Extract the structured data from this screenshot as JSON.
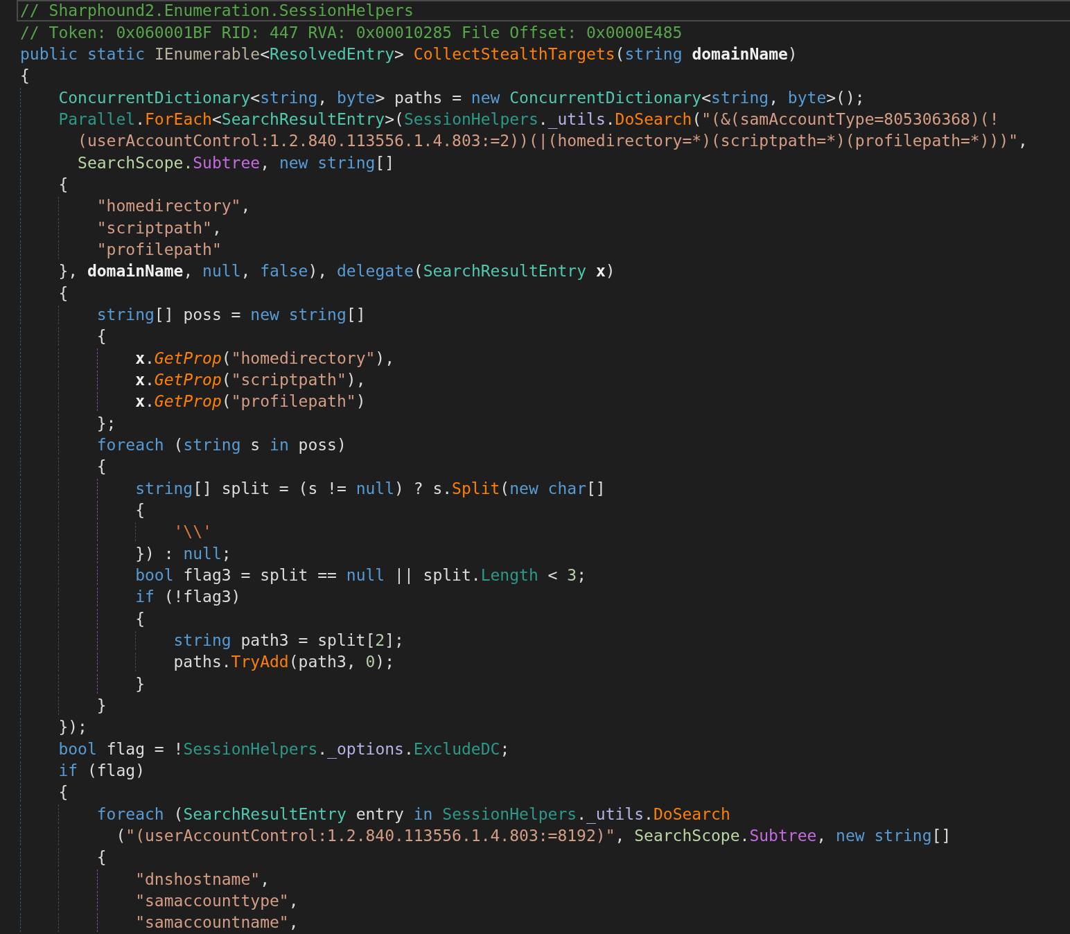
{
  "code_lines": [
    {
      "selected": true,
      "tokens": [
        {
          "kind": "comment",
          "text": "// Sharphound2.Enumeration.SessionHelpers"
        }
      ]
    },
    {
      "selected": false,
      "tokens": [
        {
          "kind": "comment",
          "text": "// Token: 0x060001BF RID: 447 RVA: 0x00010285 File Offset: 0x0000E485"
        }
      ]
    },
    {
      "selected": false,
      "tokens": [
        {
          "kind": "keyword",
          "text": "public static "
        },
        {
          "kind": "interface",
          "text": "IEnumerable"
        },
        {
          "kind": "plain",
          "text": "<"
        },
        {
          "kind": "type",
          "text": "ResolvedEntry"
        },
        {
          "kind": "plain",
          "text": "> "
        },
        {
          "kind": "method",
          "text": "CollectStealthTargets"
        },
        {
          "kind": "plain",
          "text": "("
        },
        {
          "kind": "keyword",
          "text": "string "
        },
        {
          "kind": "param",
          "text": "domainName"
        },
        {
          "kind": "plain",
          "text": ")"
        }
      ]
    },
    {
      "selected": false,
      "tokens": [
        {
          "kind": "plain",
          "text": "{"
        }
      ]
    },
    {
      "selected": false,
      "tokens": [
        {
          "kind": "type",
          "text": "    ConcurrentDictionary"
        },
        {
          "kind": "plain",
          "text": "<"
        },
        {
          "kind": "keyword",
          "text": "string"
        },
        {
          "kind": "plain",
          "text": ", "
        },
        {
          "kind": "keyword",
          "text": "byte"
        },
        {
          "kind": "plain",
          "text": "> paths = "
        },
        {
          "kind": "keyword",
          "text": "new "
        },
        {
          "kind": "type",
          "text": "ConcurrentDictionary"
        },
        {
          "kind": "plain",
          "text": "<"
        },
        {
          "kind": "keyword",
          "text": "string"
        },
        {
          "kind": "plain",
          "text": ", "
        },
        {
          "kind": "keyword",
          "text": "byte"
        },
        {
          "kind": "plain",
          "text": ">();"
        }
      ]
    },
    {
      "selected": false,
      "tokens": [
        {
          "kind": "static",
          "text": "    Parallel"
        },
        {
          "kind": "plain",
          "text": "."
        },
        {
          "kind": "method",
          "text": "ForEach"
        },
        {
          "kind": "plain",
          "text": "<"
        },
        {
          "kind": "type",
          "text": "SearchResultEntry"
        },
        {
          "kind": "plain",
          "text": ">("
        },
        {
          "kind": "static",
          "text": "SessionHelpers"
        },
        {
          "kind": "plain",
          "text": "."
        },
        {
          "kind": "field",
          "text": "_utils"
        },
        {
          "kind": "plain",
          "text": "."
        },
        {
          "kind": "method",
          "text": "DoSearch"
        },
        {
          "kind": "plain",
          "text": "("
        },
        {
          "kind": "string",
          "text": "\"(&(samAccountType=805306368)(!"
        }
      ]
    },
    {
      "selected": false,
      "tokens": [
        {
          "kind": "string",
          "text": "      (userAccountControl:1.2.840.113556.1.4.803:=2))(|(homedirectory=*)(scriptpath=*)(profilepath=*)))\""
        },
        {
          "kind": "plain",
          "text": ","
        }
      ]
    },
    {
      "selected": false,
      "tokens": [
        {
          "kind": "enum",
          "text": "      SearchScope."
        },
        {
          "kind": "enumval",
          "text": "Subtree"
        },
        {
          "kind": "plain",
          "text": ", "
        },
        {
          "kind": "keyword",
          "text": "new string"
        },
        {
          "kind": "plain",
          "text": "[]"
        }
      ]
    },
    {
      "selected": false,
      "tokens": [
        {
          "kind": "plain",
          "text": "    {"
        }
      ]
    },
    {
      "selected": false,
      "tokens": [
        {
          "kind": "string",
          "text": "        \"homedirectory\""
        },
        {
          "kind": "plain",
          "text": ","
        }
      ]
    },
    {
      "selected": false,
      "tokens": [
        {
          "kind": "string",
          "text": "        \"scriptpath\""
        },
        {
          "kind": "plain",
          "text": ","
        }
      ]
    },
    {
      "selected": false,
      "tokens": [
        {
          "kind": "string",
          "text": "        \"profilepath\""
        }
      ]
    },
    {
      "selected": false,
      "tokens": [
        {
          "kind": "plain",
          "text": "    }, "
        },
        {
          "kind": "param",
          "text": "domainName"
        },
        {
          "kind": "plain",
          "text": ", "
        },
        {
          "kind": "keyword",
          "text": "null"
        },
        {
          "kind": "plain",
          "text": ", "
        },
        {
          "kind": "keyword",
          "text": "false"
        },
        {
          "kind": "plain",
          "text": "), "
        },
        {
          "kind": "keyword",
          "text": "delegate"
        },
        {
          "kind": "plain",
          "text": "("
        },
        {
          "kind": "type",
          "text": "SearchResultEntry "
        },
        {
          "kind": "param",
          "text": "x"
        },
        {
          "kind": "plain",
          "text": ")"
        }
      ]
    },
    {
      "selected": false,
      "tokens": [
        {
          "kind": "plain",
          "text": "    {"
        }
      ]
    },
    {
      "selected": false,
      "tokens": [
        {
          "kind": "keyword",
          "text": "        string"
        },
        {
          "kind": "plain",
          "text": "[] poss = "
        },
        {
          "kind": "keyword",
          "text": "new string"
        },
        {
          "kind": "plain",
          "text": "[]"
        }
      ]
    },
    {
      "selected": false,
      "tokens": [
        {
          "kind": "plain",
          "text": "        {"
        }
      ]
    },
    {
      "selected": false,
      "tokens": [
        {
          "kind": "param",
          "text": "            x"
        },
        {
          "kind": "plain",
          "text": "."
        },
        {
          "kind": "ext",
          "text": "GetProp"
        },
        {
          "kind": "plain",
          "text": "("
        },
        {
          "kind": "string",
          "text": "\"homedirectory\""
        },
        {
          "kind": "plain",
          "text": "),"
        }
      ]
    },
    {
      "selected": false,
      "tokens": [
        {
          "kind": "param",
          "text": "            x"
        },
        {
          "kind": "plain",
          "text": "."
        },
        {
          "kind": "ext",
          "text": "GetProp"
        },
        {
          "kind": "plain",
          "text": "("
        },
        {
          "kind": "string",
          "text": "\"scriptpath\""
        },
        {
          "kind": "plain",
          "text": "),"
        }
      ]
    },
    {
      "selected": false,
      "tokens": [
        {
          "kind": "param",
          "text": "            x"
        },
        {
          "kind": "plain",
          "text": "."
        },
        {
          "kind": "ext",
          "text": "GetProp"
        },
        {
          "kind": "plain",
          "text": "("
        },
        {
          "kind": "string",
          "text": "\"profilepath\""
        },
        {
          "kind": "plain",
          "text": ")"
        }
      ]
    },
    {
      "selected": false,
      "tokens": [
        {
          "kind": "plain",
          "text": "        };"
        }
      ]
    },
    {
      "selected": false,
      "tokens": [
        {
          "kind": "keyword",
          "text": "        foreach "
        },
        {
          "kind": "plain",
          "text": "("
        },
        {
          "kind": "keyword",
          "text": "string "
        },
        {
          "kind": "plain",
          "text": "s "
        },
        {
          "kind": "keyword",
          "text": "in "
        },
        {
          "kind": "plain",
          "text": "poss)"
        }
      ]
    },
    {
      "selected": false,
      "tokens": [
        {
          "kind": "plain",
          "text": "        {"
        }
      ]
    },
    {
      "selected": false,
      "tokens": [
        {
          "kind": "keyword",
          "text": "            string"
        },
        {
          "kind": "plain",
          "text": "[] split = (s != "
        },
        {
          "kind": "keyword",
          "text": "null"
        },
        {
          "kind": "plain",
          "text": ") ? s."
        },
        {
          "kind": "method",
          "text": "Split"
        },
        {
          "kind": "plain",
          "text": "("
        },
        {
          "kind": "keyword",
          "text": "new char"
        },
        {
          "kind": "plain",
          "text": "[]"
        }
      ]
    },
    {
      "selected": false,
      "tokens": [
        {
          "kind": "plain",
          "text": "            {"
        }
      ]
    },
    {
      "selected": false,
      "tokens": [
        {
          "kind": "char",
          "text": "                '\\\\'"
        }
      ]
    },
    {
      "selected": false,
      "tokens": [
        {
          "kind": "plain",
          "text": "            }) : "
        },
        {
          "kind": "keyword",
          "text": "null"
        },
        {
          "kind": "plain",
          "text": ";"
        }
      ]
    },
    {
      "selected": false,
      "tokens": [
        {
          "kind": "keyword",
          "text": "            bool "
        },
        {
          "kind": "plain",
          "text": "flag3 = split == "
        },
        {
          "kind": "keyword",
          "text": "null "
        },
        {
          "kind": "plain",
          "text": "|| split."
        },
        {
          "kind": "property",
          "text": "Length"
        },
        {
          "kind": "plain",
          "text": " < "
        },
        {
          "kind": "number",
          "text": "3"
        },
        {
          "kind": "plain",
          "text": ";"
        }
      ]
    },
    {
      "selected": false,
      "tokens": [
        {
          "kind": "keyword",
          "text": "            if "
        },
        {
          "kind": "plain",
          "text": "(!flag3)"
        }
      ]
    },
    {
      "selected": false,
      "tokens": [
        {
          "kind": "plain",
          "text": "            {"
        }
      ]
    },
    {
      "selected": false,
      "tokens": [
        {
          "kind": "keyword",
          "text": "                string "
        },
        {
          "kind": "plain",
          "text": "path3 = split["
        },
        {
          "kind": "number",
          "text": "2"
        },
        {
          "kind": "plain",
          "text": "];"
        }
      ]
    },
    {
      "selected": false,
      "tokens": [
        {
          "kind": "plain",
          "text": "                paths."
        },
        {
          "kind": "method",
          "text": "TryAdd"
        },
        {
          "kind": "plain",
          "text": "(path3, "
        },
        {
          "kind": "number",
          "text": "0"
        },
        {
          "kind": "plain",
          "text": ");"
        }
      ]
    },
    {
      "selected": false,
      "tokens": [
        {
          "kind": "plain",
          "text": "            }"
        }
      ]
    },
    {
      "selected": false,
      "tokens": [
        {
          "kind": "plain",
          "text": "        }"
        }
      ]
    },
    {
      "selected": false,
      "tokens": [
        {
          "kind": "plain",
          "text": "    });"
        }
      ]
    },
    {
      "selected": false,
      "tokens": [
        {
          "kind": "keyword",
          "text": "    bool "
        },
        {
          "kind": "plain",
          "text": "flag = !"
        },
        {
          "kind": "static",
          "text": "SessionHelpers"
        },
        {
          "kind": "plain",
          "text": "."
        },
        {
          "kind": "field",
          "text": "_options"
        },
        {
          "kind": "plain",
          "text": "."
        },
        {
          "kind": "property",
          "text": "ExcludeDC"
        },
        {
          "kind": "plain",
          "text": ";"
        }
      ]
    },
    {
      "selected": false,
      "tokens": [
        {
          "kind": "keyword",
          "text": "    if "
        },
        {
          "kind": "plain",
          "text": "(flag)"
        }
      ]
    },
    {
      "selected": false,
      "tokens": [
        {
          "kind": "plain",
          "text": "    {"
        }
      ]
    },
    {
      "selected": false,
      "tokens": [
        {
          "kind": "keyword",
          "text": "        foreach "
        },
        {
          "kind": "plain",
          "text": "("
        },
        {
          "kind": "type",
          "text": "SearchResultEntry "
        },
        {
          "kind": "plain",
          "text": "entry "
        },
        {
          "kind": "keyword",
          "text": "in "
        },
        {
          "kind": "static",
          "text": "SessionHelpers"
        },
        {
          "kind": "plain",
          "text": "."
        },
        {
          "kind": "field",
          "text": "_utils"
        },
        {
          "kind": "plain",
          "text": "."
        },
        {
          "kind": "method",
          "text": "DoSearch"
        }
      ]
    },
    {
      "selected": false,
      "tokens": [
        {
          "kind": "plain",
          "text": "          ("
        },
        {
          "kind": "string",
          "text": "\"(userAccountControl:1.2.840.113556.1.4.803:=8192)\""
        },
        {
          "kind": "plain",
          "text": ", "
        },
        {
          "kind": "enum",
          "text": "SearchScope"
        },
        {
          "kind": "plain",
          "text": "."
        },
        {
          "kind": "enumval",
          "text": "Subtree"
        },
        {
          "kind": "plain",
          "text": ", "
        },
        {
          "kind": "keyword",
          "text": "new string"
        },
        {
          "kind": "plain",
          "text": "[]"
        }
      ]
    },
    {
      "selected": false,
      "tokens": [
        {
          "kind": "plain",
          "text": "        {"
        }
      ]
    },
    {
      "selected": false,
      "tokens": [
        {
          "kind": "string",
          "text": "            \"dnshostname\""
        },
        {
          "kind": "plain",
          "text": ","
        }
      ]
    },
    {
      "selected": false,
      "tokens": [
        {
          "kind": "string",
          "text": "            \"samaccounttype\""
        },
        {
          "kind": "plain",
          "text": ","
        }
      ]
    },
    {
      "selected": false,
      "tokens": [
        {
          "kind": "string",
          "text": "            \"samaccountname\""
        },
        {
          "kind": "plain",
          "text": ","
        }
      ]
    }
  ]
}
